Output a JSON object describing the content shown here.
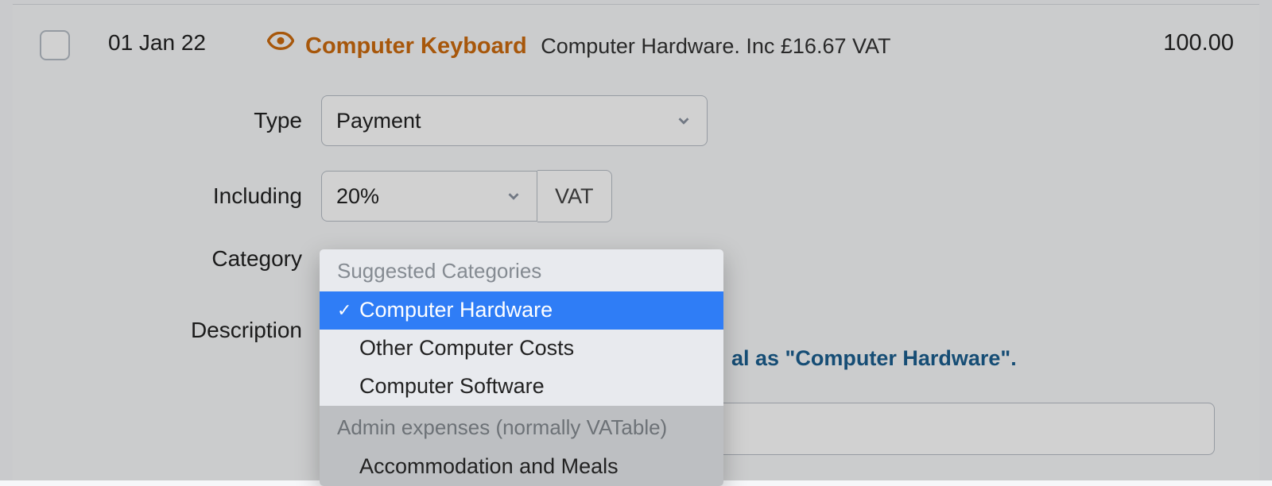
{
  "row": {
    "date": "01 Jan 22",
    "title": "Computer Keyboard",
    "meta": "Computer Hardware. Inc £16.67 VAT",
    "amount": "100.00"
  },
  "labels": {
    "type": "Type",
    "including": "Including",
    "category": "Category",
    "description": "Description"
  },
  "type": {
    "value": "Payment"
  },
  "vat": {
    "percent": "20%",
    "suffix": "VAT"
  },
  "category": {
    "hint_fragment": "al as \"Computer Hardware\".",
    "dropdown": {
      "group1_header": "Suggested Categories",
      "options1": [
        "Computer Hardware",
        "Other Computer Costs",
        "Computer Software"
      ],
      "selected": "Computer Hardware",
      "group2_header": "Admin expenses (normally VATable)",
      "options2": [
        "Accommodation and Meals"
      ]
    }
  }
}
